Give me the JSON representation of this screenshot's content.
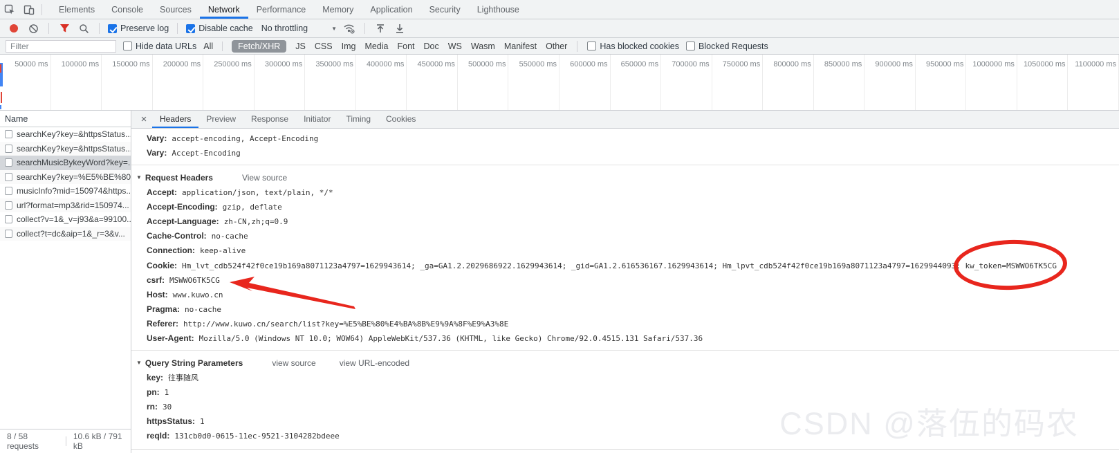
{
  "colors": {
    "accent": "#1a73e8",
    "record_red": "#e04537",
    "annotation_red": "#e8261d"
  },
  "icons": {
    "close": "×",
    "caret_down": "▼",
    "section_triangle": "▼"
  },
  "devtools": {
    "tabs": [
      "Elements",
      "Console",
      "Sources",
      "Network",
      "Performance",
      "Memory",
      "Application",
      "Security",
      "Lighthouse"
    ],
    "active_tab": "Network"
  },
  "network_toolbar": {
    "preserve_log_label": "Preserve log",
    "disable_cache_label": "Disable cache",
    "throttling_value": "No throttling"
  },
  "filter_bar": {
    "placeholder": "Filter",
    "hide_data_urls_label": "Hide data URLs",
    "types": [
      "All",
      "Fetch/XHR",
      "JS",
      "CSS",
      "Img",
      "Media",
      "Font",
      "Doc",
      "WS",
      "Wasm",
      "Manifest",
      "Other"
    ],
    "active_type": "Fetch/XHR",
    "has_blocked_cookies_label": "Has blocked cookies",
    "blocked_requests_label": "Blocked Requests"
  },
  "timeline": {
    "ticks": [
      "50000 ms",
      "100000 ms",
      "150000 ms",
      "200000 ms",
      "250000 ms",
      "300000 ms",
      "350000 ms",
      "400000 ms",
      "450000 ms",
      "500000 ms",
      "550000 ms",
      "600000 ms",
      "650000 ms",
      "700000 ms",
      "750000 ms",
      "800000 ms",
      "850000 ms",
      "900000 ms",
      "950000 ms",
      "1000000 ms",
      "1050000 ms",
      "1100000 ms"
    ]
  },
  "requests": {
    "column_header": "Name",
    "selected_index": 2,
    "items": [
      "searchKey?key=&httpsStatus...",
      "searchKey?key=&httpsStatus...",
      "searchMusicBykeyWord?key=...",
      "searchKey?key=%E5%BE%80...",
      "musicInfo?mid=150974&https...",
      "url?format=mp3&rid=150974...",
      "collect?v=1&_v=j93&a=99100...",
      "collect?t=dc&aip=1&_r=3&v..."
    ]
  },
  "status_bar": {
    "requests": "8 / 58 requests",
    "transferred": "10.6 kB / 791 kB"
  },
  "detail": {
    "tabs": [
      "Headers",
      "Preview",
      "Response",
      "Initiator",
      "Timing",
      "Cookies"
    ],
    "active_tab": "Headers",
    "response_tail": [
      {
        "name": "Vary:",
        "value": "accept-encoding, Accept-Encoding"
      },
      {
        "name": "Vary:",
        "value": "Accept-Encoding"
      }
    ],
    "request_headers": {
      "title": "Request Headers",
      "view_source_label": "View source",
      "entries_before_cookie": [
        {
          "name": "Accept:",
          "value": "application/json, text/plain, */*"
        },
        {
          "name": "Accept-Encoding:",
          "value": "gzip, deflate"
        },
        {
          "name": "Accept-Language:",
          "value": "zh-CN,zh;q=0.9"
        },
        {
          "name": "Cache-Control:",
          "value": "no-cache"
        },
        {
          "name": "Connection:",
          "value": "keep-alive"
        }
      ],
      "cookie": {
        "name": "Cookie:",
        "value_prefix": "Hm_lvt_cdb524f42f0ce19b169a8071123a4797=1629943614; _ga=GA1.2.2029686922.1629943614; _gid=GA1.2.616536167.1629943614; Hm_lpvt_cdb524f42f0ce19b169a8071123a4797=1629944093; ",
        "highlighted": "kw_token=MSWWO6TK5CG"
      },
      "csrf": {
        "name": "csrf:",
        "value": "MSWWO6TK5CG"
      },
      "entries_after_csrf": [
        {
          "name": "Host:",
          "value": "www.kuwo.cn"
        },
        {
          "name": "Pragma:",
          "value": "no-cache"
        },
        {
          "name": "Referer:",
          "value": "http://www.kuwo.cn/search/list?key=%E5%BE%80%E4%BA%8B%E9%9A%8F%E9%A3%8E"
        },
        {
          "name": "User-Agent:",
          "value": "Mozilla/5.0 (Windows NT 10.0; WOW64) AppleWebKit/537.36 (KHTML, like Gecko) Chrome/92.0.4515.131 Safari/537.36"
        }
      ]
    },
    "query_params": {
      "title": "Query String Parameters",
      "view_source_label": "view source",
      "view_url_encoded_label": "view URL-encoded",
      "entries": [
        {
          "name": "key:",
          "value": "往事随风"
        },
        {
          "name": "pn:",
          "value": "1"
        },
        {
          "name": "rn:",
          "value": "30"
        },
        {
          "name": "httpsStatus:",
          "value": "1"
        },
        {
          "name": "reqId:",
          "value": "131cb0d0-0615-11ec-9521-3104282bdeee"
        }
      ]
    }
  },
  "watermark": "CSDN @落伍的码农"
}
